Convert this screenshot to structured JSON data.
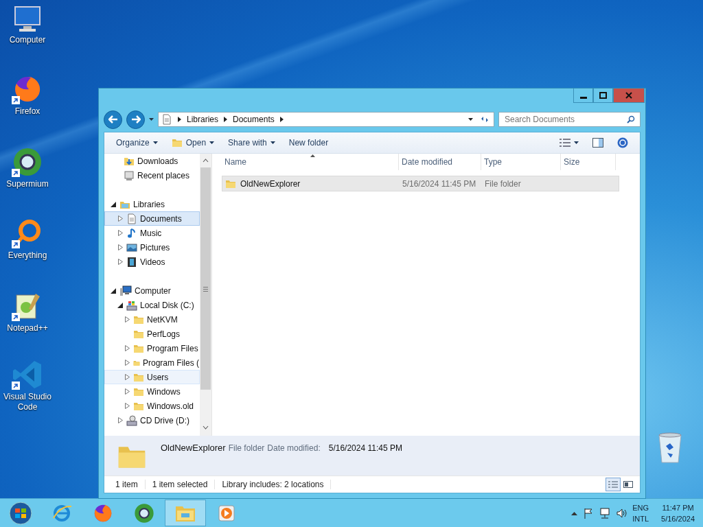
{
  "desktop_icons": [
    {
      "label": "Computer",
      "kind": "computer",
      "shortcut": false
    },
    {
      "label": "Firefox",
      "kind": "firefox",
      "shortcut": true
    },
    {
      "label": "Supermium",
      "kind": "supermium",
      "shortcut": true
    },
    {
      "label": "Everything",
      "kind": "everything",
      "shortcut": true
    },
    {
      "label": "Notepad++",
      "kind": "notepad",
      "shortcut": true
    },
    {
      "label": "Visual Studio Code",
      "kind": "vscode",
      "shortcut": true
    },
    {
      "kind": "recycle",
      "shortcut": false
    }
  ],
  "window": {
    "controls": [
      {
        "kind": "minimize"
      },
      {
        "kind": "maximize"
      },
      {
        "kind": "close"
      }
    ],
    "address": {
      "crumbs": [
        "Libraries",
        "Documents"
      ]
    },
    "search": {
      "placeholder": "Search Documents"
    },
    "toolbar": [
      {
        "label": "Organize",
        "kind": "menu"
      },
      {
        "label": "Open",
        "kind": "icon-menu"
      },
      {
        "label": "Share with",
        "kind": "menu"
      },
      {
        "label": "New folder",
        "kind": "button"
      }
    ],
    "nav_pane": {
      "top_items": [
        {
          "label": "Downloads",
          "kind": "downloads"
        },
        {
          "label": "Recent places",
          "kind": "recent"
        }
      ],
      "tree": [
        {
          "label": "Libraries",
          "kind": "library",
          "expandable": true,
          "expanded": true,
          "selected": false,
          "hovered": false,
          "children": [
            {
              "label": "Documents",
              "kind": "documents",
              "expandable": true,
              "expanded": false,
              "selected": true,
              "hovered": false
            },
            {
              "label": "Music",
              "kind": "music",
              "expandable": true,
              "expanded": false,
              "selected": false,
              "hovered": false
            },
            {
              "label": "Pictures",
              "kind": "pictures",
              "expandable": true,
              "expanded": false,
              "selected": false,
              "hovered": false
            },
            {
              "label": "Videos",
              "kind": "videos",
              "expandable": true,
              "expanded": false,
              "selected": false,
              "hovered": false
            }
          ]
        },
        {
          "label": "Computer",
          "kind": "computer",
          "expandable": true,
          "expanded": true,
          "selected": false,
          "hovered": false,
          "children": [
            {
              "label": "Local Disk (C:)",
              "kind": "disk",
              "expandable": true,
              "expanded": true,
              "selected": false,
              "hovered": false,
              "children": [
                {
                  "label": "NetKVM",
                  "kind": "folder",
                  "expandable": true,
                  "expanded": false,
                  "selected": false,
                  "hovered": false
                },
                {
                  "label": "PerfLogs",
                  "kind": "folder",
                  "expandable": false,
                  "selected": false,
                  "hovered": false
                },
                {
                  "label": "Program Files",
                  "kind": "folder",
                  "expandable": true,
                  "expanded": false,
                  "selected": false,
                  "hovered": false
                },
                {
                  "label": "Program Files (",
                  "kind": "folder",
                  "expandable": true,
                  "expanded": false,
                  "selected": false,
                  "hovered": false
                },
                {
                  "label": "Users",
                  "kind": "folder",
                  "expandable": true,
                  "expanded": false,
                  "selected": false,
                  "hovered": true
                },
                {
                  "label": "Windows",
                  "kind": "folder",
                  "expandable": true,
                  "expanded": false,
                  "selected": false,
                  "hovered": false
                },
                {
                  "label": "Windows.old",
                  "kind": "folder",
                  "expandable": true,
                  "expanded": false,
                  "selected": false,
                  "hovered": false
                }
              ]
            },
            {
              "label": "CD Drive (D:)",
              "kind": "cd",
              "expandable": true,
              "expanded": false,
              "selected": false,
              "hovered": false
            }
          ]
        }
      ]
    },
    "file_list": {
      "columns": [
        {
          "label": "Name",
          "sorted": true
        },
        {
          "label": "Date modified",
          "sorted": false
        },
        {
          "label": "Type",
          "sorted": false
        },
        {
          "label": "Size",
          "sorted": false
        }
      ],
      "rows": [
        {
          "name": "OldNewExplorer",
          "date_modified": "5/16/2024 11:45 PM",
          "type": "File folder",
          "selected": true
        }
      ]
    },
    "details_pane": {
      "name": "OldNewExplorer",
      "type": "File folder",
      "field_label": "Date modified:",
      "field_value": "5/16/2024 11:45 PM"
    },
    "status_bar": [
      "1 item",
      "1 item selected",
      "Library includes: 2 locations"
    ],
    "views": [
      {
        "kind": "details",
        "selected": true
      },
      {
        "kind": "tiles",
        "selected": false
      }
    ]
  },
  "taskbar": {
    "apps": [
      {
        "kind": "ie",
        "selected": false
      },
      {
        "kind": "firefox",
        "selected": false
      },
      {
        "kind": "supermium",
        "selected": false
      },
      {
        "kind": "explorer",
        "selected": true
      },
      {
        "kind": "media",
        "selected": false
      }
    ],
    "language": [
      "ENG",
      "INTL"
    ],
    "time": "11:47 PM",
    "date": "5/16/2024"
  }
}
